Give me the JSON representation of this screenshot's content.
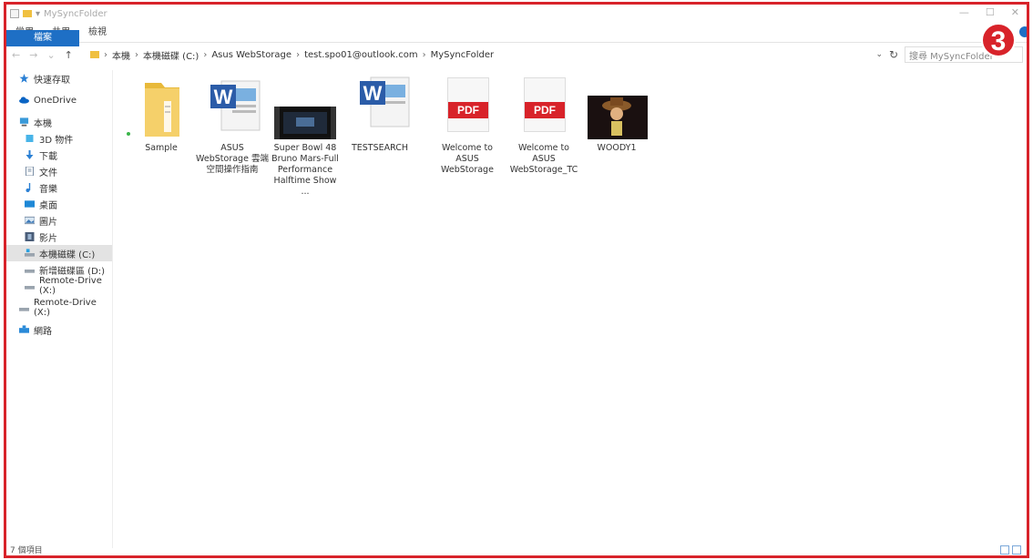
{
  "window": {
    "title": "MySyncFolder"
  },
  "ribbon": {
    "tabs": [
      "檔案",
      "常用",
      "共用",
      "檢視"
    ]
  },
  "address": {
    "crumbs": [
      "本機",
      "本機磁碟 (C:)",
      "Asus WebStorage",
      "test.spo01@outlook.com",
      "MySyncFolder"
    ],
    "separator": "›"
  },
  "search": {
    "placeholder": "搜尋 MySyncFolder"
  },
  "badge": {
    "number": "3"
  },
  "sidebar": {
    "items": [
      {
        "label": "快速存取",
        "icon": "star-icon"
      },
      {
        "label": "OneDrive",
        "icon": "cloud-icon"
      },
      {
        "label": "本機",
        "icon": "computer-icon"
      },
      {
        "label": "3D 物件",
        "icon": "cube-icon"
      },
      {
        "label": "下載",
        "icon": "download-icon"
      },
      {
        "label": "文件",
        "icon": "document-icon"
      },
      {
        "label": "音樂",
        "icon": "music-icon"
      },
      {
        "label": "桌面",
        "icon": "desktop-icon"
      },
      {
        "label": "圖片",
        "icon": "pictures-icon"
      },
      {
        "label": "影片",
        "icon": "video-icon"
      },
      {
        "label": "本機磁碟 (C:)",
        "icon": "drive-icon"
      },
      {
        "label": "新增磁碟區 (D:)",
        "icon": "drive-icon"
      },
      {
        "label": "Remote-Drive (X:)",
        "icon": "network-drive-icon"
      },
      {
        "label": "Remote-Drive (X:)",
        "icon": "network-drive-icon"
      },
      {
        "label": "網路",
        "icon": "network-icon"
      }
    ]
  },
  "files": [
    {
      "name": "Sample",
      "type": "folder"
    },
    {
      "name": "ASUS WebStorage 雲端空間操作指南",
      "type": "word"
    },
    {
      "name": "Super Bowl 48 Bruno Mars-Full Performance Halftime Show ...",
      "type": "video"
    },
    {
      "name": "TESTSEARCH",
      "type": "word"
    },
    {
      "name": "Welcome to ASUS WebStorage",
      "type": "pdf",
      "badge": "PDF"
    },
    {
      "name": "Welcome to ASUS WebStorage_TC",
      "type": "pdf",
      "badge": "PDF"
    },
    {
      "name": "WOODY1",
      "type": "image"
    }
  ],
  "status": {
    "count": "7 個項目"
  },
  "colors": {
    "accent": "#1e6fc5",
    "highlight_border": "#d8232a"
  }
}
